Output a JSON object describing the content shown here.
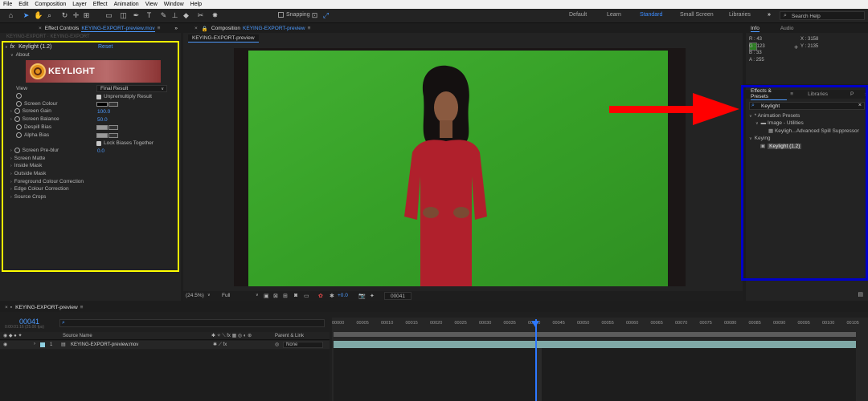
{
  "menu": [
    "File",
    "Edit",
    "Composition",
    "Layer",
    "Effect",
    "Animation",
    "View",
    "Window",
    "Help"
  ],
  "toolbar": {
    "snapping_label": "Snapping",
    "workspaces": [
      "Default",
      "Learn",
      "Standard",
      "Small Screen",
      "Libraries"
    ],
    "active_workspace": "Standard",
    "search_placeholder": "Search Help"
  },
  "effect_controls": {
    "tab_prefix": "Effect Controls",
    "tab_file": "KEYING-EXPORT-preview.mov",
    "ghost_tabs": "KEYING-EXPORT · KEYING-EXPORT",
    "effect_name": "Keylight (1.2)",
    "reset": "Reset",
    "about": "About",
    "logo_text": "KEYLIGHT",
    "view_label": "View",
    "view_value": "Final Result",
    "unpremultiply": "Unpremultiply Result",
    "screen_colour": "Screen Colour",
    "screen_gain": "Screen Gain",
    "screen_gain_value": "100.0",
    "screen_balance": "Screen Balance",
    "screen_balance_value": "50.0",
    "despill_bias": "Despill Bias",
    "alpha_bias": "Alpha Bias",
    "lock_biases": "Lock Biases Together",
    "screen_preblur": "Screen Pre-blur",
    "screen_preblur_value": "0.0",
    "groups": [
      "Screen Matte",
      "Inside Mask",
      "Outside Mask",
      "Foreground Colour Correction",
      "Edge Colour Correction",
      "Source Crops"
    ]
  },
  "composition": {
    "tab_prefix": "Composition",
    "tab_name": "KEYING-EXPORT-preview",
    "subtab": "KEYING-EXPORT-preview",
    "zoom": "(24.5%)",
    "resolution": "Full",
    "exposure": "+0.0",
    "frame": "00041"
  },
  "info": {
    "tabs": [
      "Info",
      "Audio"
    ],
    "r": "R : 43",
    "g": "G : 123",
    "b": "B : 33",
    "a": "A : 255",
    "x": "X : 3158",
    "y": "Y : 2135",
    "swatch_color": "#2b7b21"
  },
  "effects_presets": {
    "tabs": [
      "Effects & Presets",
      "Libraries",
      "P"
    ],
    "search_value": "Keylight",
    "animation_presets": "* Animation Presets",
    "image_utilities": "Image - Utilities",
    "spill_preset": "Keyligh...Advanced Spill Suppressor",
    "keying": "Keying",
    "keylight_item": "Keylight (1.2)"
  },
  "timeline": {
    "tab": "KEYING-EXPORT-preview",
    "timecode": "00041",
    "timecode_sub": "0:00:01:16 (25.00 fps)",
    "source_name_header": "Source Name",
    "parent_header": "Parent & Link",
    "layer_num": "1",
    "layer_name": "KEYING-EXPORT-preview.mov",
    "parent_value": "None",
    "ruler": [
      "00000",
      "00005",
      "00010",
      "00015",
      "00020",
      "00025",
      "00030",
      "00035",
      "00040",
      "00045",
      "00050",
      "00055",
      "00060",
      "00065",
      "00070",
      "00075",
      "00080",
      "00085",
      "00090",
      "00095",
      "00100",
      "00105"
    ]
  },
  "colors": {
    "accent": "#4d9bff",
    "highlight_yellow": "#ffff00",
    "highlight_blue": "#0000c8",
    "arrow_red": "#ff0000",
    "green_screen": "#3aa52a"
  }
}
